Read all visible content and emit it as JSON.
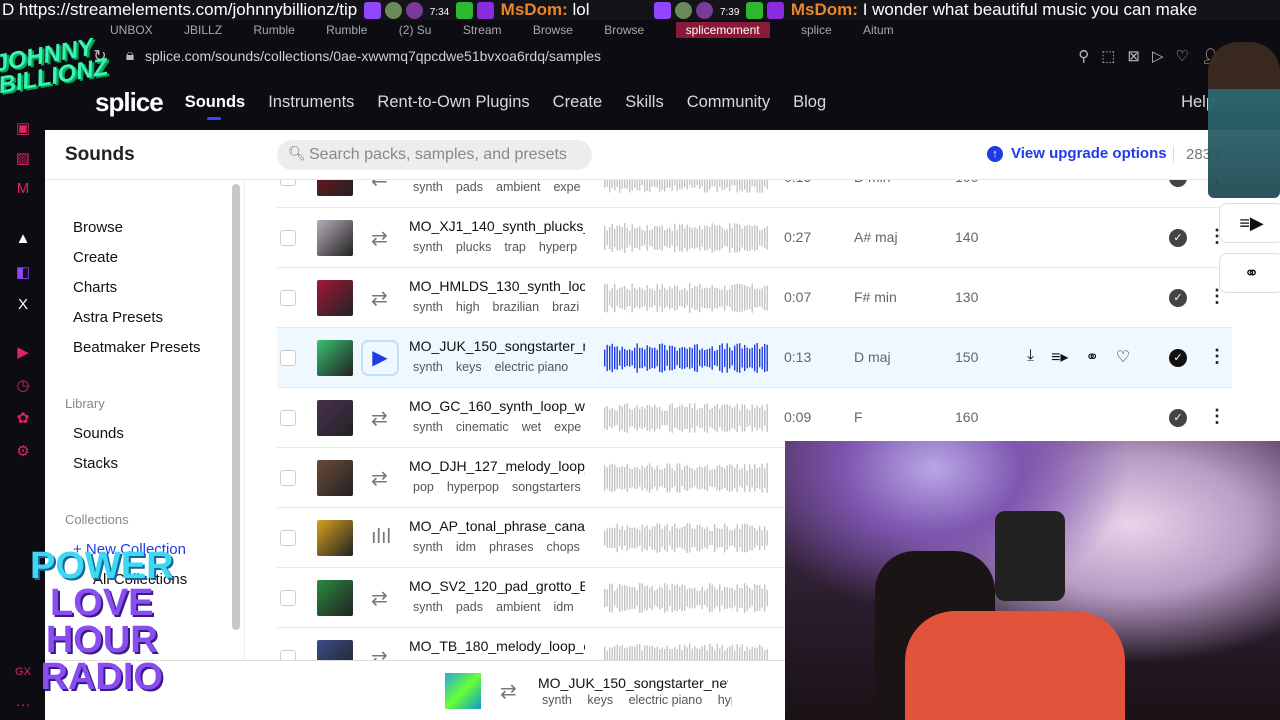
{
  "overlay": {
    "chat": [
      {
        "text": "D https://streamelements.com/johnnybillionz/tip"
      },
      {
        "time": "7:34",
        "user": "MsDom:",
        "message": "lol"
      },
      {
        "time": "7:39",
        "user": "MsDom:",
        "message": "I wonder what beautiful music you can make"
      }
    ],
    "brand_logo": "JOHNNY BILLIONZ",
    "radio_logo": [
      "POWER",
      "LOVE",
      "HOUR",
      "RADIO"
    ]
  },
  "browser": {
    "tabs": [
      "UNBOX",
      "JBILLZ",
      "Rumble",
      "Rumble",
      "(2) Su",
      "Stream",
      "Browse",
      "Browse",
      "splicemoment",
      "splice",
      "Aitum"
    ],
    "url": "splice.com/sounds/collections/0ae-xwwmq7qpcdwe51bvxoa6rdq/samples",
    "sidebar_badge": "GX"
  },
  "nav": {
    "logo": "splice",
    "items": [
      "Sounds",
      "Instruments",
      "Rent-to-Own Plugins",
      "Create",
      "Skills",
      "Community",
      "Blog"
    ],
    "help": "Help"
  },
  "header": {
    "title": "Sounds",
    "search_placeholder": "Search packs, samples, and presets",
    "upgrade": "View upgrade options",
    "credits": "283 c"
  },
  "sidebar": {
    "items": [
      "Browse",
      "Create",
      "Charts",
      "Astra Presets",
      "Beatmaker Presets"
    ],
    "library_heading": "Library",
    "library": [
      "Sounds",
      "Stacks"
    ],
    "collections_heading": "Collections",
    "new_collection": "+ New Collection",
    "all_collections": "All Collections"
  },
  "rows": [
    {
      "name": "",
      "tags": [
        "synth",
        "pads",
        "ambient",
        "expe"
      ],
      "duration": "0:15",
      "key": "D min",
      "bpm": "100",
      "icon": "loop",
      "art": "#7a1420"
    },
    {
      "name": "MO_XJ1_140_synth_plucks_",
      "tags": [
        "synth",
        "plucks",
        "trap",
        "hyperp"
      ],
      "duration": "0:27",
      "key": "A# maj",
      "bpm": "140",
      "icon": "loop",
      "art": "#b5aebb"
    },
    {
      "name": "MO_HMLDS_130_synth_loop",
      "tags": [
        "synth",
        "high",
        "brazilian",
        "brazi"
      ],
      "duration": "0:07",
      "key": "F# min",
      "bpm": "130",
      "icon": "loop",
      "art": "#a01838"
    },
    {
      "name": "MO_JUK_150_songstarter_n",
      "tags": [
        "synth",
        "keys",
        "electric piano"
      ],
      "duration": "0:13",
      "key": "D maj",
      "bpm": "150",
      "icon": "play",
      "art": "#3ac070",
      "active": true
    },
    {
      "name": "MO_GC_160_synth_loop_we",
      "tags": [
        "synth",
        "cinematic",
        "wet",
        "expe"
      ],
      "duration": "0:09",
      "key": "F",
      "bpm": "160",
      "icon": "loop",
      "art": "#4a3050"
    },
    {
      "name": "MO_DJH_127_melody_loop_",
      "tags": [
        "pop",
        "hyperpop",
        "songstarters"
      ],
      "duration": "",
      "key": "",
      "bpm": "",
      "icon": "loop",
      "art": "#6a4a3a"
    },
    {
      "name": "MO_AP_tonal_phrase_cana",
      "tags": [
        "synth",
        "idm",
        "phrases",
        "chops"
      ],
      "duration": "",
      "key": "",
      "bpm": "",
      "icon": "wave",
      "art": "#d8a020"
    },
    {
      "name": "MO_SV2_120_pad_grotto_B",
      "tags": [
        "synth",
        "pads",
        "ambient",
        "idm"
      ],
      "duration": "",
      "key": "",
      "bpm": "",
      "icon": "loop",
      "art": "#2a8a40"
    },
    {
      "name": "MO_TB_180_melody_loop_o",
      "tags": [],
      "duration": "",
      "key": "",
      "bpm": "",
      "icon": "loop",
      "art": "#3a4a8a"
    }
  ],
  "player": {
    "name": "MO_JUK_150_songstarter_nev",
    "tags": [
      "synth",
      "keys",
      "electric piano",
      "hyp"
    ]
  },
  "colors": {
    "accent": "#1f3be8",
    "nav_bg": "#0d0c12",
    "active_row": "#eef8fe"
  }
}
